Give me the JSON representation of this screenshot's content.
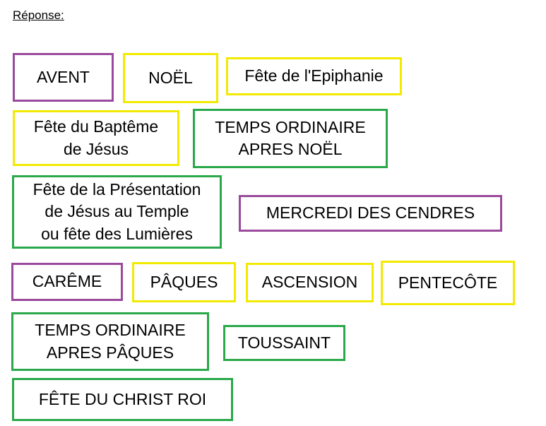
{
  "heading": "Réponse:",
  "colors": {
    "purple": "#9a4a9c",
    "yellow": "#f2ea00",
    "green": "#2aa84a"
  },
  "cards": [
    {
      "text": "AVENT",
      "color": "purple"
    },
    {
      "text": "NOËL",
      "color": "yellow"
    },
    {
      "text": "Fête de l'Epiphanie",
      "color": "yellow"
    },
    {
      "text": "Fête du Baptême\n   de Jésus",
      "color": "yellow"
    },
    {
      "text": "TEMPS ORDINAIRE\nAPRES NOËL",
      "color": "green"
    },
    {
      "text": "Fête de la Présentation\nde Jésus au Temple\nou fête des Lumières",
      "color": "green"
    },
    {
      "text": "MERCREDI DES CENDRES",
      "color": "purple"
    },
    {
      "text": "CARÊME",
      "color": "purple"
    },
    {
      "text": "PÂQUES",
      "color": "yellow"
    },
    {
      "text": "ASCENSION",
      "color": "yellow"
    },
    {
      "text": "PENTECÔTE",
      "color": "yellow"
    },
    {
      "text": "TEMPS ORDINAIRE\nAPRES PÂQUES",
      "color": "green"
    },
    {
      "text": "TOUSSAINT",
      "color": "green"
    },
    {
      "text": "FÊTE DU CHRIST ROI",
      "color": "green"
    }
  ]
}
